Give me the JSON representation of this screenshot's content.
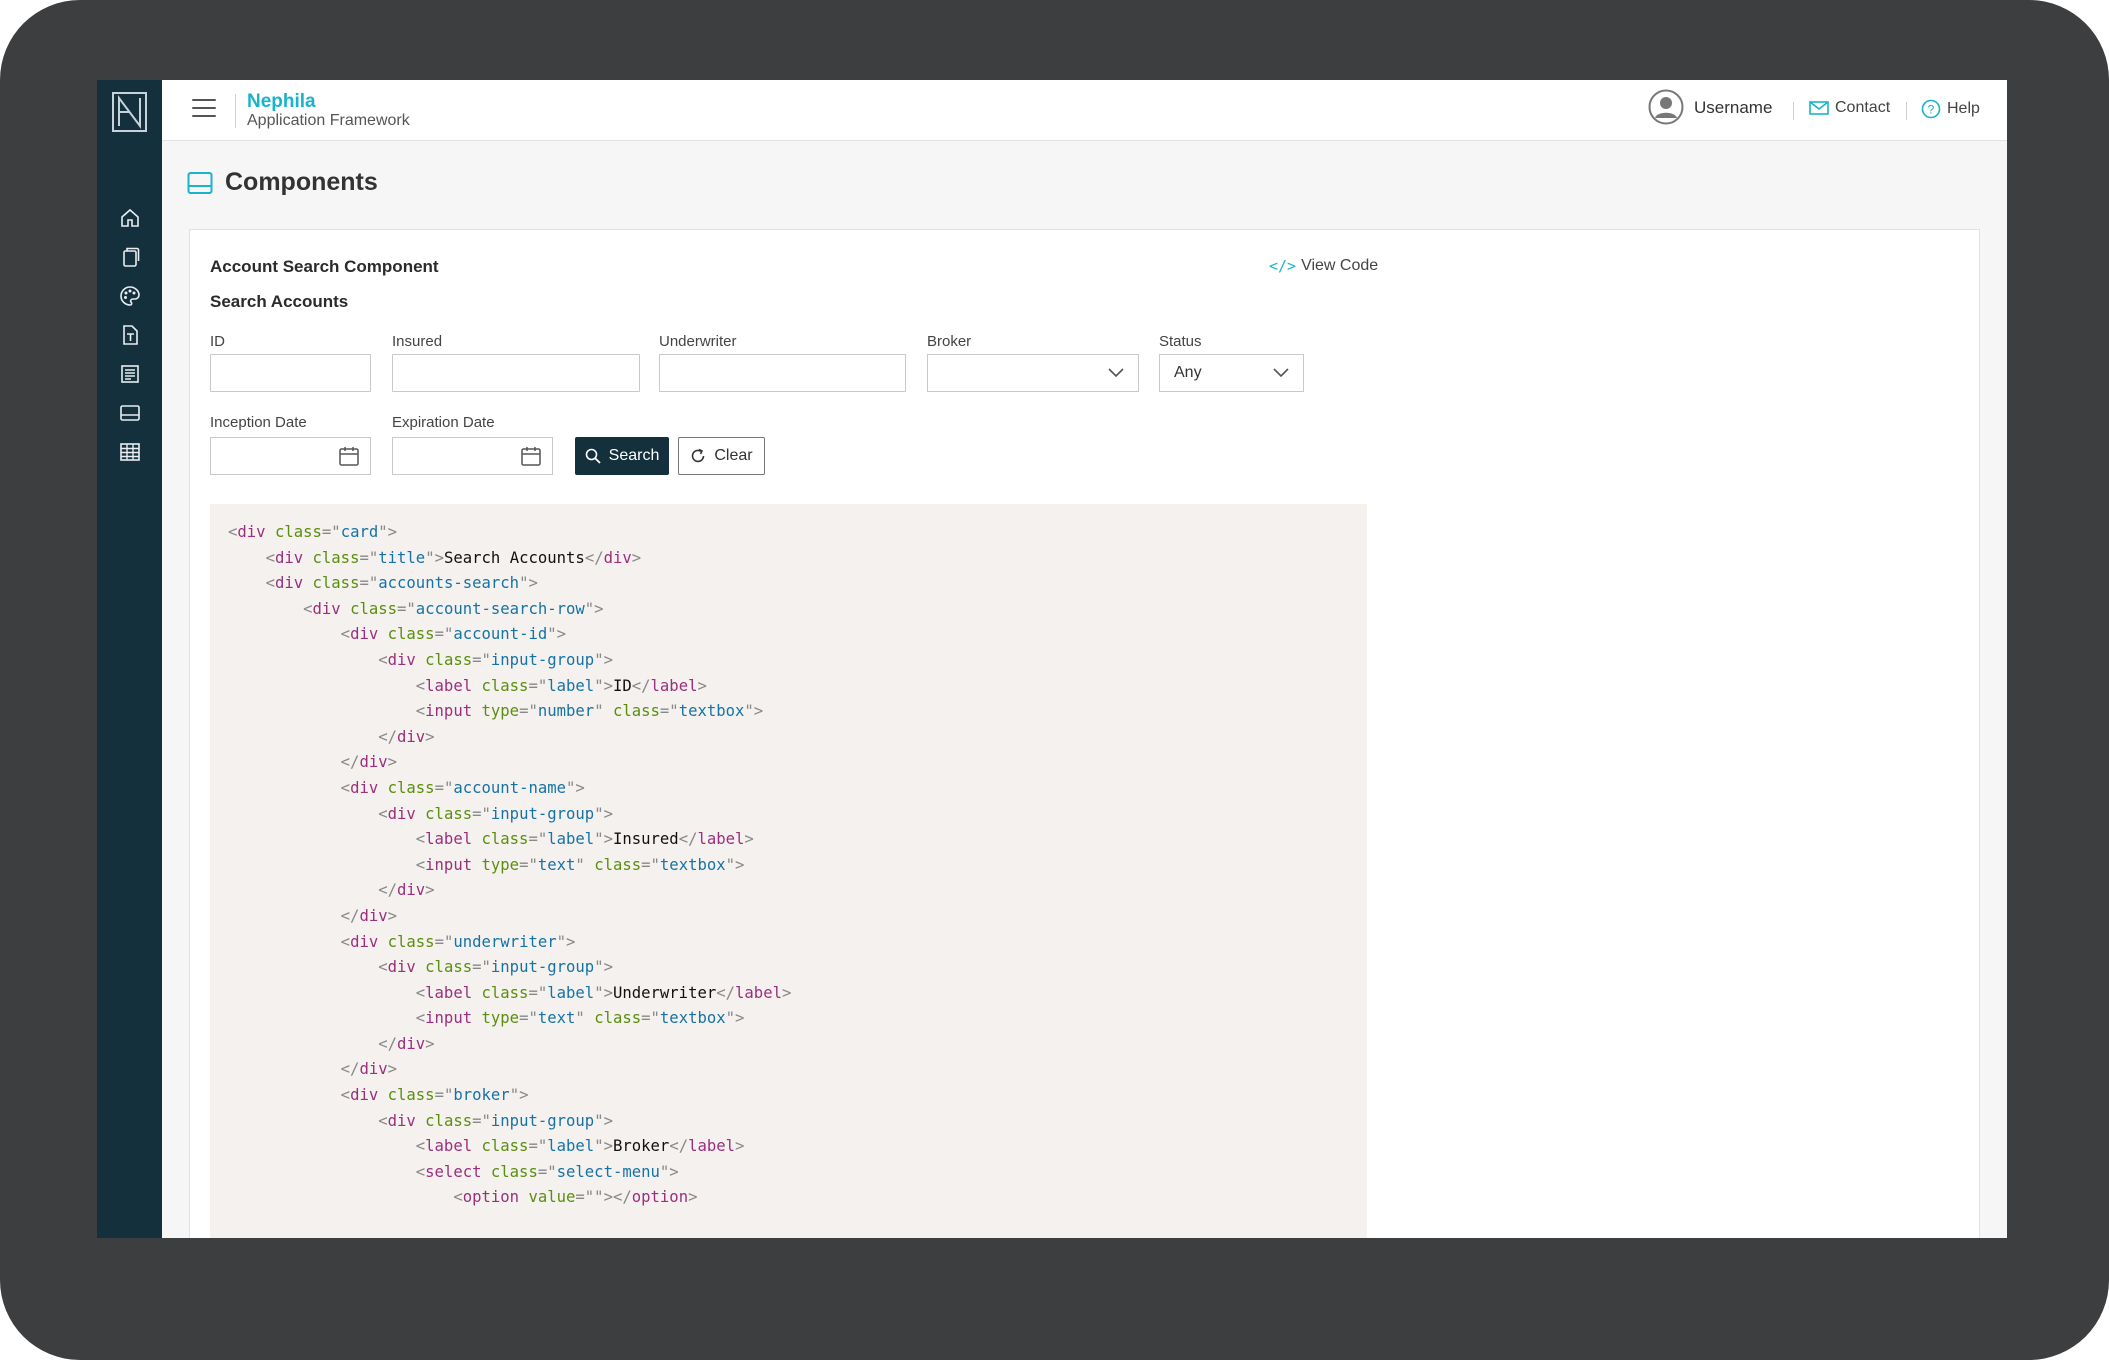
{
  "app": {
    "brand_name": "Nephila",
    "brand_subtitle": "Application Framework"
  },
  "sidebar": {
    "items": [
      {
        "icon": "home-icon"
      },
      {
        "icon": "pages-icon"
      },
      {
        "icon": "palette-icon"
      },
      {
        "icon": "typography-icon"
      },
      {
        "icon": "forms-icon"
      },
      {
        "icon": "components-icon"
      },
      {
        "icon": "table-icon"
      }
    ]
  },
  "header": {
    "username": "Username",
    "contact_label": "Contact",
    "help_label": "Help"
  },
  "page": {
    "title": "Components"
  },
  "card": {
    "title": "Account Search Component",
    "view_code_label": "View Code",
    "subtitle": "Search Accounts",
    "fields": {
      "id_label": "ID",
      "insured_label": "Insured",
      "underwriter_label": "Underwriter",
      "broker_label": "Broker",
      "broker_value": "",
      "status_label": "Status",
      "status_value": "Any",
      "inception_label": "Inception Date",
      "expiration_label": "Expiration Date"
    },
    "search_button": "Search",
    "clear_button": "Clear"
  },
  "code": [
    {
      "indent": 0,
      "tokens": [
        [
          "p",
          "<"
        ],
        [
          "t",
          "div"
        ],
        [
          "p",
          " "
        ],
        [
          "a",
          "class"
        ],
        [
          "p",
          "=\""
        ],
        [
          "v",
          "card"
        ],
        [
          "p",
          "\">"
        ]
      ]
    },
    {
      "indent": 1,
      "tokens": [
        [
          "p",
          "<"
        ],
        [
          "t",
          "div"
        ],
        [
          "p",
          " "
        ],
        [
          "a",
          "class"
        ],
        [
          "p",
          "=\""
        ],
        [
          "v",
          "title"
        ],
        [
          "p",
          "\">"
        ],
        [
          "x",
          "Search Accounts"
        ],
        [
          "p",
          "</"
        ],
        [
          "t",
          "div"
        ],
        [
          "p",
          ">"
        ]
      ]
    },
    {
      "indent": 1,
      "tokens": [
        [
          "p",
          "<"
        ],
        [
          "t",
          "div"
        ],
        [
          "p",
          " "
        ],
        [
          "a",
          "class"
        ],
        [
          "p",
          "=\""
        ],
        [
          "v",
          "accounts-search"
        ],
        [
          "p",
          "\">"
        ]
      ]
    },
    {
      "indent": 2,
      "tokens": [
        [
          "p",
          "<"
        ],
        [
          "t",
          "div"
        ],
        [
          "p",
          " "
        ],
        [
          "a",
          "class"
        ],
        [
          "p",
          "=\""
        ],
        [
          "v",
          "account-search-row"
        ],
        [
          "p",
          "\">"
        ]
      ]
    },
    {
      "indent": 3,
      "tokens": [
        [
          "p",
          "<"
        ],
        [
          "t",
          "div"
        ],
        [
          "p",
          " "
        ],
        [
          "a",
          "class"
        ],
        [
          "p",
          "=\""
        ],
        [
          "v",
          "account-id"
        ],
        [
          "p",
          "\">"
        ]
      ]
    },
    {
      "indent": 4,
      "tokens": [
        [
          "p",
          "<"
        ],
        [
          "t",
          "div"
        ],
        [
          "p",
          " "
        ],
        [
          "a",
          "class"
        ],
        [
          "p",
          "=\""
        ],
        [
          "v",
          "input-group"
        ],
        [
          "p",
          "\">"
        ]
      ]
    },
    {
      "indent": 5,
      "tokens": [
        [
          "p",
          "<"
        ],
        [
          "t",
          "label"
        ],
        [
          "p",
          " "
        ],
        [
          "a",
          "class"
        ],
        [
          "p",
          "=\""
        ],
        [
          "v",
          "label"
        ],
        [
          "p",
          "\">"
        ],
        [
          "x",
          "ID"
        ],
        [
          "p",
          "</"
        ],
        [
          "t",
          "label"
        ],
        [
          "p",
          ">"
        ]
      ]
    },
    {
      "indent": 5,
      "tokens": [
        [
          "p",
          "<"
        ],
        [
          "t",
          "input"
        ],
        [
          "p",
          " "
        ],
        [
          "a",
          "type"
        ],
        [
          "p",
          "=\""
        ],
        [
          "v",
          "number"
        ],
        [
          "p",
          "\" "
        ],
        [
          "a",
          "class"
        ],
        [
          "p",
          "=\""
        ],
        [
          "v",
          "textbox"
        ],
        [
          "p",
          "\">"
        ]
      ]
    },
    {
      "indent": 4,
      "tokens": [
        [
          "p",
          "</"
        ],
        [
          "t",
          "div"
        ],
        [
          "p",
          ">"
        ]
      ]
    },
    {
      "indent": 3,
      "tokens": [
        [
          "p",
          "</"
        ],
        [
          "t",
          "div"
        ],
        [
          "p",
          ">"
        ]
      ]
    },
    {
      "indent": 3,
      "tokens": [
        [
          "p",
          "<"
        ],
        [
          "t",
          "div"
        ],
        [
          "p",
          " "
        ],
        [
          "a",
          "class"
        ],
        [
          "p",
          "=\""
        ],
        [
          "v",
          "account-name"
        ],
        [
          "p",
          "\">"
        ]
      ]
    },
    {
      "indent": 4,
      "tokens": [
        [
          "p",
          "<"
        ],
        [
          "t",
          "div"
        ],
        [
          "p",
          " "
        ],
        [
          "a",
          "class"
        ],
        [
          "p",
          "=\""
        ],
        [
          "v",
          "input-group"
        ],
        [
          "p",
          "\">"
        ]
      ]
    },
    {
      "indent": 5,
      "tokens": [
        [
          "p",
          "<"
        ],
        [
          "t",
          "label"
        ],
        [
          "p",
          " "
        ],
        [
          "a",
          "class"
        ],
        [
          "p",
          "=\""
        ],
        [
          "v",
          "label"
        ],
        [
          "p",
          "\">"
        ],
        [
          "x",
          "Insured"
        ],
        [
          "p",
          "</"
        ],
        [
          "t",
          "label"
        ],
        [
          "p",
          ">"
        ]
      ]
    },
    {
      "indent": 5,
      "tokens": [
        [
          "p",
          "<"
        ],
        [
          "t",
          "input"
        ],
        [
          "p",
          " "
        ],
        [
          "a",
          "type"
        ],
        [
          "p",
          "=\""
        ],
        [
          "v",
          "text"
        ],
        [
          "p",
          "\" "
        ],
        [
          "a",
          "class"
        ],
        [
          "p",
          "=\""
        ],
        [
          "v",
          "textbox"
        ],
        [
          "p",
          "\">"
        ]
      ]
    },
    {
      "indent": 4,
      "tokens": [
        [
          "p",
          "</"
        ],
        [
          "t",
          "div"
        ],
        [
          "p",
          ">"
        ]
      ]
    },
    {
      "indent": 3,
      "tokens": [
        [
          "p",
          "</"
        ],
        [
          "t",
          "div"
        ],
        [
          "p",
          ">"
        ]
      ]
    },
    {
      "indent": 3,
      "tokens": [
        [
          "p",
          "<"
        ],
        [
          "t",
          "div"
        ],
        [
          "p",
          " "
        ],
        [
          "a",
          "class"
        ],
        [
          "p",
          "=\""
        ],
        [
          "v",
          "underwriter"
        ],
        [
          "p",
          "\">"
        ]
      ]
    },
    {
      "indent": 4,
      "tokens": [
        [
          "p",
          "<"
        ],
        [
          "t",
          "div"
        ],
        [
          "p",
          " "
        ],
        [
          "a",
          "class"
        ],
        [
          "p",
          "=\""
        ],
        [
          "v",
          "input-group"
        ],
        [
          "p",
          "\">"
        ]
      ]
    },
    {
      "indent": 5,
      "tokens": [
        [
          "p",
          "<"
        ],
        [
          "t",
          "label"
        ],
        [
          "p",
          " "
        ],
        [
          "a",
          "class"
        ],
        [
          "p",
          "=\""
        ],
        [
          "v",
          "label"
        ],
        [
          "p",
          "\">"
        ],
        [
          "x",
          "Underwriter"
        ],
        [
          "p",
          "</"
        ],
        [
          "t",
          "label"
        ],
        [
          "p",
          ">"
        ]
      ]
    },
    {
      "indent": 5,
      "tokens": [
        [
          "p",
          "<"
        ],
        [
          "t",
          "input"
        ],
        [
          "p",
          " "
        ],
        [
          "a",
          "type"
        ],
        [
          "p",
          "=\""
        ],
        [
          "v",
          "text"
        ],
        [
          "p",
          "\" "
        ],
        [
          "a",
          "class"
        ],
        [
          "p",
          "=\""
        ],
        [
          "v",
          "textbox"
        ],
        [
          "p",
          "\">"
        ]
      ]
    },
    {
      "indent": 4,
      "tokens": [
        [
          "p",
          "</"
        ],
        [
          "t",
          "div"
        ],
        [
          "p",
          ">"
        ]
      ]
    },
    {
      "indent": 3,
      "tokens": [
        [
          "p",
          "</"
        ],
        [
          "t",
          "div"
        ],
        [
          "p",
          ">"
        ]
      ]
    },
    {
      "indent": 3,
      "tokens": [
        [
          "p",
          "<"
        ],
        [
          "t",
          "div"
        ],
        [
          "p",
          " "
        ],
        [
          "a",
          "class"
        ],
        [
          "p",
          "=\""
        ],
        [
          "v",
          "broker"
        ],
        [
          "p",
          "\">"
        ]
      ]
    },
    {
      "indent": 4,
      "tokens": [
        [
          "p",
          "<"
        ],
        [
          "t",
          "div"
        ],
        [
          "p",
          " "
        ],
        [
          "a",
          "class"
        ],
        [
          "p",
          "=\""
        ],
        [
          "v",
          "input-group"
        ],
        [
          "p",
          "\">"
        ]
      ]
    },
    {
      "indent": 5,
      "tokens": [
        [
          "p",
          "<"
        ],
        [
          "t",
          "label"
        ],
        [
          "p",
          " "
        ],
        [
          "a",
          "class"
        ],
        [
          "p",
          "=\""
        ],
        [
          "v",
          "label"
        ],
        [
          "p",
          "\">"
        ],
        [
          "x",
          "Broker"
        ],
        [
          "p",
          "</"
        ],
        [
          "t",
          "label"
        ],
        [
          "p",
          ">"
        ]
      ]
    },
    {
      "indent": 5,
      "tokens": [
        [
          "p",
          "<"
        ],
        [
          "t",
          "select"
        ],
        [
          "p",
          " "
        ],
        [
          "a",
          "class"
        ],
        [
          "p",
          "=\""
        ],
        [
          "v",
          "select-menu"
        ],
        [
          "p",
          "\">"
        ]
      ]
    },
    {
      "indent": 6,
      "tokens": [
        [
          "p",
          "<"
        ],
        [
          "t",
          "option"
        ],
        [
          "p",
          " "
        ],
        [
          "a",
          "value"
        ],
        [
          "p",
          "=\"\">"
        ],
        [
          "p",
          "</"
        ],
        [
          "t",
          "option"
        ],
        [
          "p",
          ">"
        ]
      ]
    }
  ]
}
